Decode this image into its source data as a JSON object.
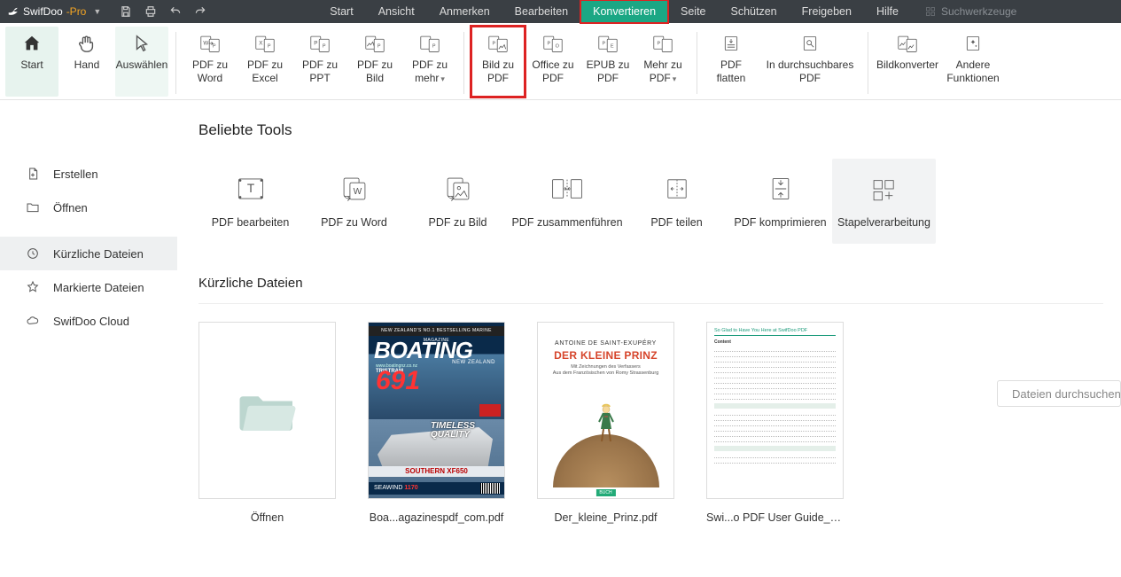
{
  "title": {
    "brand": "SwifDoo",
    "suffix": "-Pro"
  },
  "menu": {
    "items": [
      "Start",
      "Ansicht",
      "Anmerken",
      "Bearbeiten",
      "Konvertieren",
      "Seite",
      "Schützen",
      "Freigeben",
      "Hilfe"
    ],
    "active": "Konvertieren",
    "highlighted": "Konvertieren"
  },
  "searchTools": {
    "placeholder": "Suchwerkzeuge"
  },
  "ribbon": {
    "start": "Start",
    "hand": "Hand",
    "select": "Auswählen",
    "toWord": "PDF zu Word",
    "toExcel": "PDF zu Excel",
    "toPPT": "PDF zu PPT",
    "toImage": "PDF zu Bild",
    "toMore": "PDF zu mehr",
    "imgToPdf": "Bild zu PDF",
    "officeToPdf": "Office zu PDF",
    "epubToPdf": "EPUB zu PDF",
    "moreToPdf": "Mehr zu PDF",
    "flatten": "PDF flatten",
    "searchable": "In durchsuchbares PDF",
    "imgConverter": "Bildkonverter",
    "otherFunctions": "Andere Funktionen"
  },
  "sidebar": {
    "create": "Erstellen",
    "open": "Öffnen",
    "recent": "Kürzliche Dateien",
    "marked": "Markierte Dateien",
    "cloud": "SwifDoo Cloud"
  },
  "popularTools": {
    "title": "Beliebte Tools",
    "items": [
      "PDF bearbeiten",
      "PDF zu Word",
      "PDF zu Bild",
      "PDF zusammenführen",
      "PDF teilen",
      "PDF komprimieren",
      "Stapelverarbeitung"
    ]
  },
  "recent": {
    "title": "Kürzliche Dateien",
    "searchPlaceholder": "Dateien durchsuchen",
    "openLabel": "Öffnen",
    "files": [
      "Boa...agazinespdf_com.pdf",
      "Der_kleine_Prinz.pdf",
      "Swi...o PDF User Guide_L.pdf"
    ]
  },
  "covers": {
    "boating": {
      "banner": "NEW ZEALAND'S NO.1 BESTSELLING MARINE MAGAZINE",
      "title": "BOATING",
      "subtitle": "NEW ZEALAND",
      "site": "www.boatingnz.co.nz",
      "tristram": "TRISTRAM",
      "big": "691",
      "timeless1": "TIMELESS",
      "timeless2": "QUALITY",
      "xf": "SOUTHERN XF650",
      "sea": "SEAWIND",
      "seaNum": "1170"
    },
    "prinz": {
      "author": "ANTOINE DE SAINT-EXUPÉRY",
      "title": "DER KLEINE PRINZ",
      "sub1": "Mit Zeichnungen des Verfassers",
      "sub2": "Aus dem Französischen von Romy Strassenburg",
      "pub": "BUCH"
    },
    "guide": {
      "title": "So Glad to Have You Here at SwifDoo PDF",
      "content": "Content"
    }
  }
}
